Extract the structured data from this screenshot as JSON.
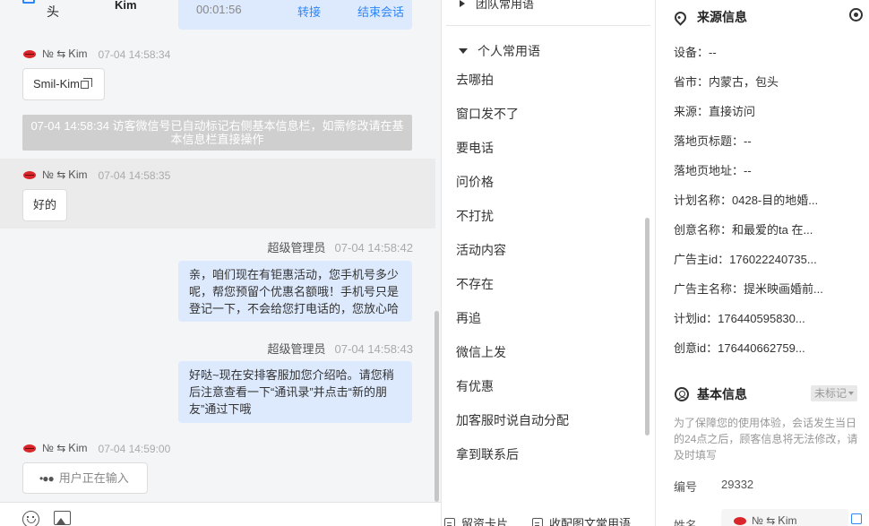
{
  "header": {
    "visitor_prefix": "头",
    "visitor_name": "Kim",
    "timer": "00:01:56",
    "transfer_label": "转接",
    "end_label": "结束会话"
  },
  "messages": {
    "m1": {
      "sender": "№ ⇆ Ꮶim",
      "time": "07-04 14:58:34",
      "text": "Smil-Kim"
    },
    "system_note": "07-04 14:58:34 访客微信号已自动标记右侧基本信息栏，如需修改请在基本信息栏直接操作",
    "m2": {
      "sender": "№ ⇆ Ꮶim",
      "time": "07-04 14:58:35",
      "text": "好的"
    },
    "m3": {
      "sender": "超级管理员",
      "time": "07-04 14:58:42",
      "text": "亲，咱们现在有钜惠活动，您手机号多少呢，帮您预留个优惠名额哦！手机号只是登记一下，不会给您打电话的，您放心哈"
    },
    "m4": {
      "sender": "超级管理员",
      "time": "07-04 14:58:43",
      "text": "好哒~现在安排客服加您介绍哈。请您稍后注意查看一下“通讯录”并点击“新的朋友”通过下哦"
    },
    "m5": {
      "sender": "№ ⇆ Ꮶim",
      "time": "07-04 14:59:00",
      "typing_dots": "•●●",
      "typing_text": "用户正在输入"
    }
  },
  "toolbar": {
    "emoji_icon": "smile-icon",
    "image_icon": "image-icon"
  },
  "phrases": {
    "team_group": "团队常用语",
    "personal_group": "个人常用语",
    "items": [
      "去哪拍",
      "窗口发不了",
      "要电话",
      "问价格",
      "不打扰",
      "活动内容",
      "不存在",
      "再追",
      "微信上发",
      "有优惠",
      "加客服时说自动分配",
      "拿到联系后"
    ],
    "tools": {
      "card": "留资卡片",
      "image_text": "收配图文常用语"
    }
  },
  "source_info": {
    "title": "来源信息",
    "fields": [
      {
        "label": "设备：",
        "value": "--"
      },
      {
        "label": "省市：",
        "value": "内蒙古，包头"
      },
      {
        "label": "来源：",
        "value": "直接访问"
      },
      {
        "label": "落地页标题：",
        "value": "--"
      },
      {
        "label": "落地页地址：",
        "value": "--"
      },
      {
        "label": "计划名称：",
        "value": "0428-目的地婚..."
      },
      {
        "label": "创意名称：",
        "value": "和最爱的ta 在..."
      },
      {
        "label": "广告主id：",
        "value": "17602224073​5..."
      },
      {
        "label": "广告主名称：",
        "value": "提米映画婚前..."
      },
      {
        "label": "计划id：",
        "value": "17644059583​0..."
      },
      {
        "label": "创意id：",
        "value": "17644066275​9..."
      }
    ]
  },
  "basic_info": {
    "title": "基本信息",
    "badge": "未标记",
    "notice": "为了保障您的使用体验，会话发生当日的24点之后，顾客信息将无法修改，请及时填写",
    "serial_label": "编号",
    "serial_value": "29332",
    "name_label": "姓名",
    "name_value": "№ ⇆ Ꮶim"
  }
}
